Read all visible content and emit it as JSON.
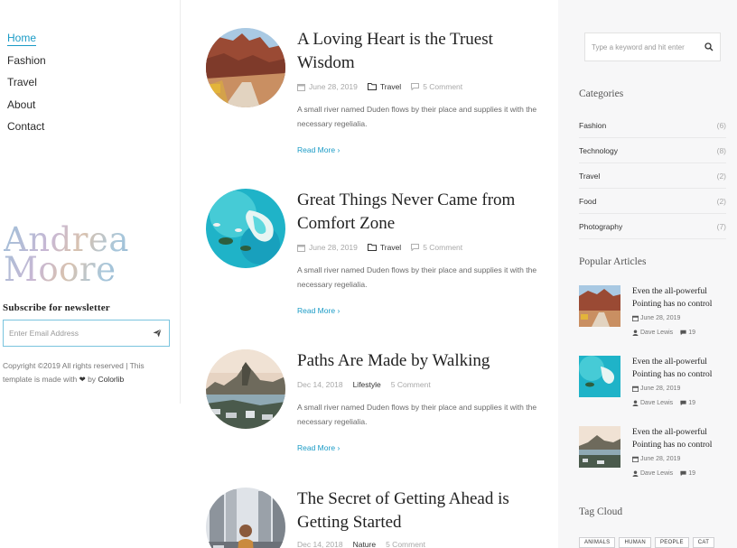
{
  "nav": [
    "Home",
    "Fashion",
    "Travel",
    "About",
    "Contact"
  ],
  "brand": {
    "line1": "Andrea",
    "line2": "Moore"
  },
  "newsletter": {
    "title": "Subscribe for newsletter",
    "placeholder": "Enter Email Address"
  },
  "footer": {
    "text1": "Copyright ©2019 All rights reserved | This template is made with",
    "text2": "by",
    "brand": "Colorlib"
  },
  "posts": [
    {
      "title": "A Loving Heart is the Truest Wisdom",
      "date": "June 28, 2019",
      "category": "Travel",
      "comments": "5 Comment",
      "excerpt": "A small river named Duden flows by their place and supplies it with the necessary regelialia.",
      "read_more": "Read More"
    },
    {
      "title": "Great Things Never Came from Comfort Zone",
      "date": "June 28, 2019",
      "category": "Travel",
      "comments": "5 Comment",
      "excerpt": "A small river named Duden flows by their place and supplies it with the necessary regelialia.",
      "read_more": "Read More"
    },
    {
      "title": "Paths Are Made by Walking",
      "date": "Dec 14, 2018",
      "category": "Lifestyle",
      "comments": "5 Comment",
      "excerpt": "A small river named Duden flows by their place and supplies it with the necessary regelialia.",
      "read_more": "Read More"
    },
    {
      "title": "The Secret of Getting Ahead is Getting Started",
      "date": "Dec 14, 2018",
      "category": "Nature",
      "comments": "5 Comment"
    }
  ],
  "sidebar": {
    "search_placeholder": "Type a keyword and hit enter",
    "categories_title": "Categories",
    "categories": [
      {
        "name": "Fashion",
        "count": "(6)"
      },
      {
        "name": "Technology",
        "count": "(8)"
      },
      {
        "name": "Travel",
        "count": "(2)"
      },
      {
        "name": "Food",
        "count": "(2)"
      },
      {
        "name": "Photography",
        "count": "(7)"
      }
    ],
    "popular_title": "Popular Articles",
    "popular": [
      {
        "title": "Even the all-powerful Pointing has no control",
        "date": "June 28, 2019",
        "author": "Dave Lewis",
        "comments": "19"
      },
      {
        "title": "Even the all-powerful Pointing has no control",
        "date": "June 28, 2019",
        "author": "Dave Lewis",
        "comments": "19"
      },
      {
        "title": "Even the all-powerful Pointing has no control",
        "date": "June 28, 2019",
        "author": "Dave Lewis",
        "comments": "19"
      }
    ],
    "tag_cloud_title": "Tag Cloud",
    "tags": [
      "ANIMALS",
      "HUMAN",
      "PEOPLE",
      "CAT"
    ]
  },
  "colors": {
    "accent": "#1a9bc6",
    "sidebar_bg": "#f7f7f8"
  }
}
